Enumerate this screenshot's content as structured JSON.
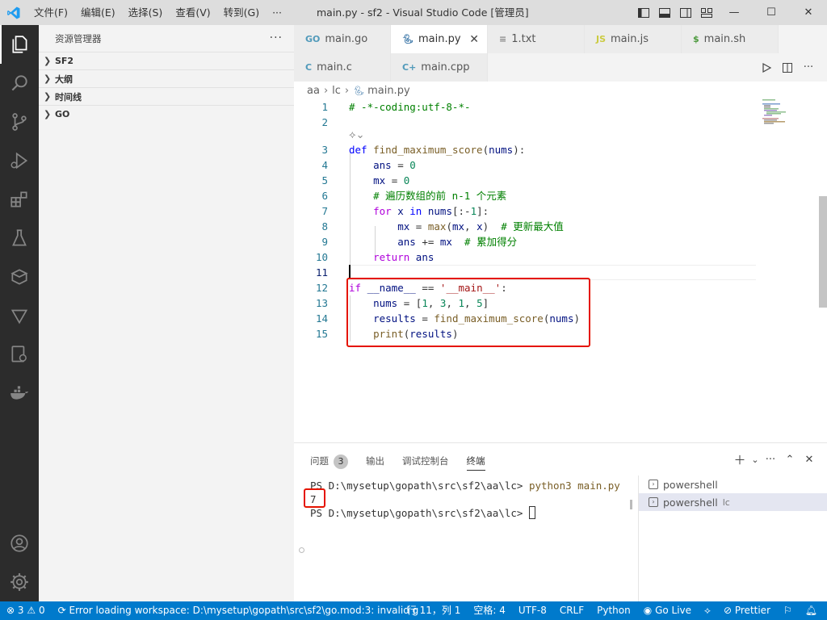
{
  "window": {
    "title": "main.py - sf2 - Visual Studio Code [管理员]",
    "menu": [
      "文件(F)",
      "编辑(E)",
      "选择(S)",
      "查看(V)",
      "转到(G)",
      "···"
    ],
    "controls": {
      "minimize": "—",
      "maximize": "☐",
      "close": "✕"
    }
  },
  "sidebar": {
    "title": "资源管理器",
    "more": "···",
    "sections": [
      "SF2",
      "大纲",
      "时间线",
      "GO"
    ]
  },
  "tabs": [
    {
      "label": "main.go",
      "icon": "GO",
      "icon_color": "#519aba"
    },
    {
      "label": "main.py",
      "icon": "py",
      "icon_color": "#3572A5",
      "active": true
    },
    {
      "label": "1.txt",
      "icon": "≡",
      "icon_color": "#888888"
    },
    {
      "label": "main.js",
      "icon": "JS",
      "icon_color": "#cbcb41"
    },
    {
      "label": "main.sh",
      "icon": "$",
      "icon_color": "#4d5a5e"
    },
    {
      "label": "main.c",
      "icon": "C",
      "icon_color": "#519aba"
    },
    {
      "label": "main.cpp",
      "icon": "C+",
      "icon_color": "#519aba"
    }
  ],
  "breadcrumb": [
    "aa",
    "lc",
    "main.py"
  ],
  "editor": {
    "codelens_icon": "copilot-icon",
    "lines": [
      {
        "n": "1",
        "text": "# -*-coding:utf-8-*-"
      },
      {
        "n": "2",
        "text": ""
      },
      {
        "n": "3",
        "text": "def find_maximum_score(nums):"
      },
      {
        "n": "4",
        "text": "    ans = 0"
      },
      {
        "n": "5",
        "text": "    mx = 0"
      },
      {
        "n": "6",
        "text": "    # 遍历数组的前 n-1 个元素"
      },
      {
        "n": "7",
        "text": "    for x in nums[:-1]:"
      },
      {
        "n": "8",
        "text": "        mx = max(mx, x)  # 更新最大值"
      },
      {
        "n": "9",
        "text": "        ans += mx  # 累加得分"
      },
      {
        "n": "10",
        "text": "    return ans"
      },
      {
        "n": "11",
        "text": ""
      },
      {
        "n": "12",
        "text": "if __name__ == '__main__':"
      },
      {
        "n": "13",
        "text": "    nums = [1, 3, 1, 5]"
      },
      {
        "n": "14",
        "text": "    results = find_maximum_score(nums)"
      },
      {
        "n": "15",
        "text": "    print(results)"
      }
    ]
  },
  "panel": {
    "tabs": [
      {
        "label": "问题",
        "badge": "3"
      },
      {
        "label": "输出"
      },
      {
        "label": "调试控制台"
      },
      {
        "label": "终端",
        "active": true
      }
    ],
    "terminal": {
      "prompt1": "PS D:\\mysetup\\gopath\\src\\sf2\\aa\\lc> ",
      "cmd1": "python3 main.py",
      "output": "7",
      "prompt2": "PS D:\\mysetup\\gopath\\src\\sf2\\aa\\lc> "
    },
    "terminal_list": [
      {
        "label": "powershell",
        "suffix": ""
      },
      {
        "label": "powershell",
        "suffix": "lc",
        "selected": true
      }
    ]
  },
  "statusbar": {
    "errors": "3",
    "warnings": "0",
    "message": "Error loading workspace: D:\\mysetup\\gopath\\src\\sf2\\go.mod:3: invalid g",
    "position": "行 11，列 1",
    "spaces": "空格: 4",
    "encoding": "UTF-8",
    "eol": "CRLF",
    "language": "Python",
    "golive": "Go Live",
    "prettier": "Prettier",
    "color_bg": "#007acc"
  }
}
